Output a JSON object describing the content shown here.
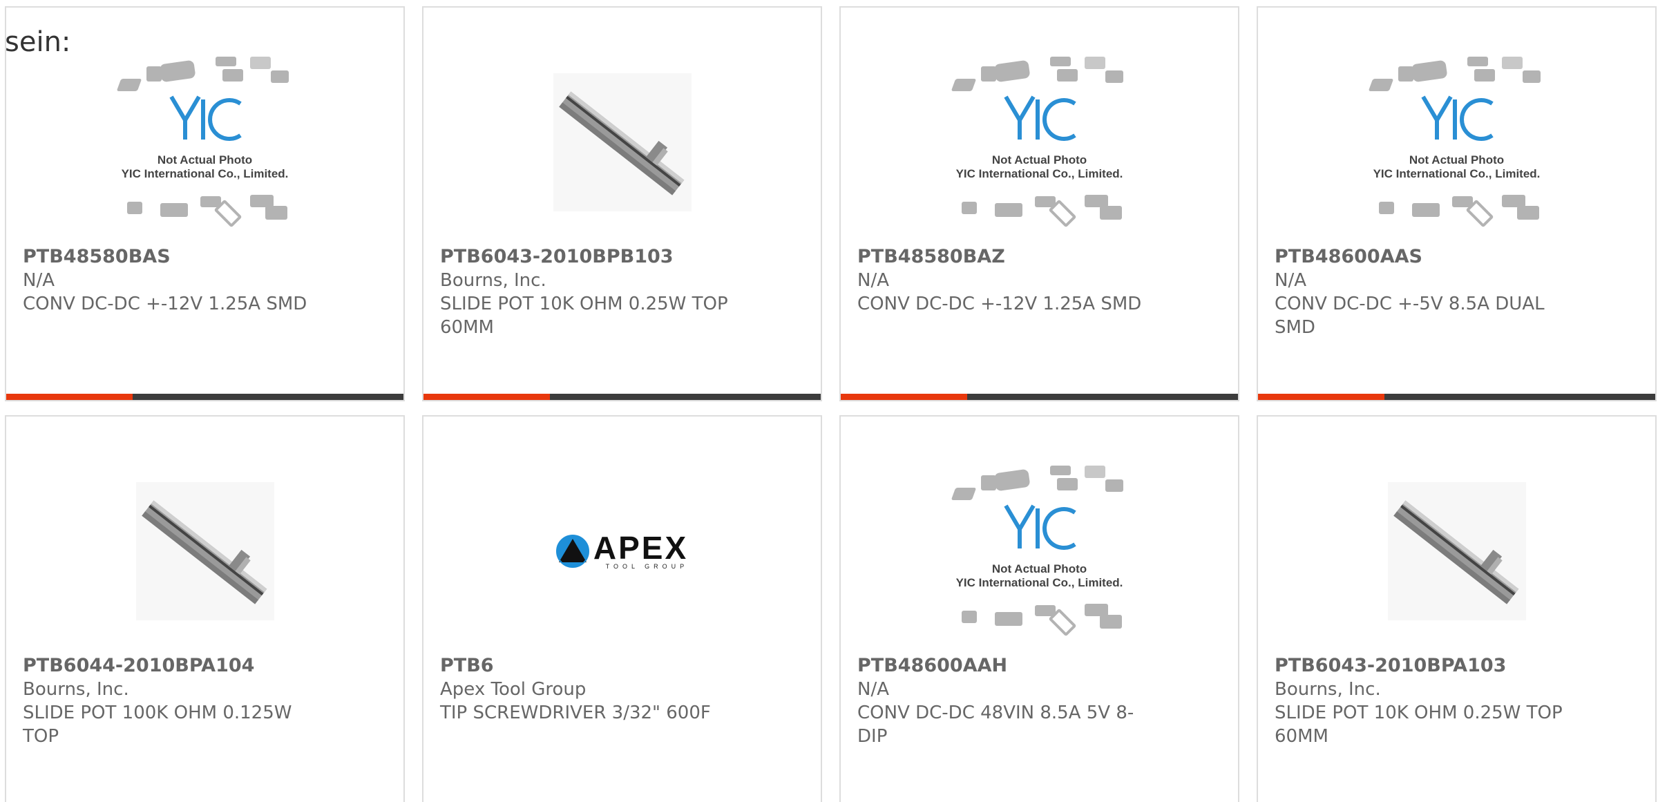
{
  "heading": "sein:",
  "products": [
    {
      "part": "PTB48580BAS",
      "maker": "N/A",
      "desc": "CONV DC-DC +-12V 1.25A SMD",
      "image": "yic-placeholder"
    },
    {
      "part": "PTB6043-2010BPB103",
      "maker": "Bourns, Inc.",
      "desc": "SLIDE POT 10K OHM 0.25W TOP 60MM",
      "image": "slide-pot"
    },
    {
      "part": "PTB48580BAZ",
      "maker": "N/A",
      "desc": "CONV DC-DC +-12V 1.25A SMD",
      "image": "yic-placeholder"
    },
    {
      "part": "PTB48600AAS",
      "maker": "N/A",
      "desc": "CONV DC-DC +-5V 8.5A DUAL SMD",
      "image": "yic-placeholder"
    },
    {
      "part": "PTB6044-2010BPA104",
      "maker": "Bourns, Inc.",
      "desc": "SLIDE POT 100K OHM 0.125W TOP",
      "image": "slide-pot"
    },
    {
      "part": "PTB6",
      "maker": "Apex Tool Group",
      "desc": "TIP SCREWDRIVER 3/32\" 600F",
      "image": "apex-logo"
    },
    {
      "part": "PTB48600AAH",
      "maker": "N/A",
      "desc": "CONV DC-DC 48VIN 8.5A 5V 8-DIP",
      "image": "yic-placeholder"
    },
    {
      "part": "PTB6043-2010BPA103",
      "maker": "Bourns, Inc.",
      "desc": "SLIDE POT 10K OHM 0.25W TOP 60MM",
      "image": "slide-pot"
    }
  ],
  "yic": {
    "line1": "Not Actual Photo",
    "line2": "YIC International Co., Limited.",
    "logo": "YIC"
  },
  "apex": {
    "word": "APEX",
    "sub": "TOOL GROUP"
  },
  "colors": {
    "accent": "#e8380d",
    "bar": "#3c3c3c",
    "border": "#dddddd",
    "text": "#666666"
  }
}
